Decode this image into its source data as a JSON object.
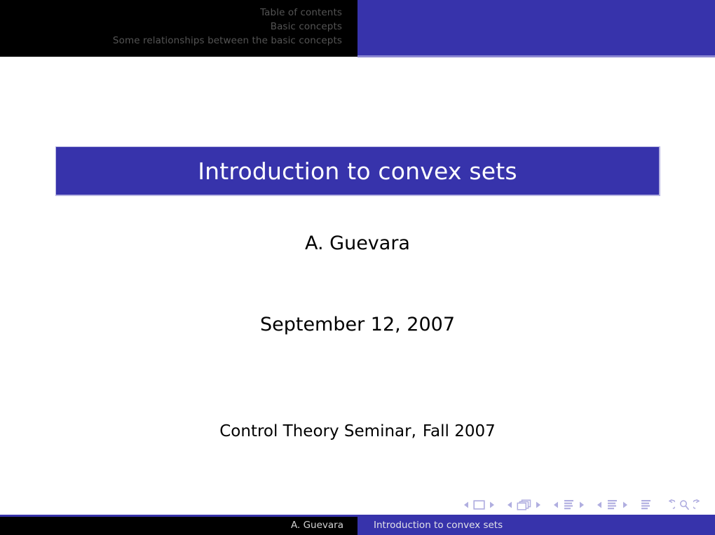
{
  "slide": {
    "background_color": "#ffffff",
    "accent_color": "#3733ab",
    "accent_light_color": "#b9b7e2"
  },
  "header": {
    "left_background": "#000000",
    "right_background": "#3733ab",
    "text_color": "#545454",
    "lines": [
      "Table of contents",
      "Basic concepts",
      "Some relationships between the basic concepts"
    ]
  },
  "title_block": {
    "title": "Introduction to convex sets",
    "background": "#3733ab",
    "text_color": "#ffffff"
  },
  "body": {
    "author": "A. Guevara",
    "date": "September 12, 2007",
    "event_prefix": "Control Theory Seminar,",
    "event_suffix": "Fall 2007"
  },
  "navigation_symbols": {
    "color": "#b0aee0",
    "groups": [
      {
        "name": "slide",
        "icons": [
          "prev-arrow-icon",
          "slide-icon",
          "next-arrow-icon"
        ]
      },
      {
        "name": "frame",
        "icons": [
          "prev-arrow-icon",
          "frame-stack-icon",
          "next-arrow-icon"
        ]
      },
      {
        "name": "subsection",
        "icons": [
          "prev-arrow-icon",
          "subsection-lines-icon",
          "next-arrow-icon"
        ]
      },
      {
        "name": "section",
        "icons": [
          "prev-arrow-icon",
          "section-lines-icon",
          "next-arrow-icon"
        ]
      },
      {
        "name": "presentation",
        "icons": [
          "document-lines-icon"
        ]
      },
      {
        "name": "history",
        "icons": [
          "back-arrow-icon",
          "search-icon",
          "forward-arrow-icon"
        ]
      }
    ]
  },
  "footer": {
    "left_background": "#000000",
    "right_background": "#3733ab",
    "author": "A. Guevara",
    "title": "Introduction to convex sets"
  }
}
